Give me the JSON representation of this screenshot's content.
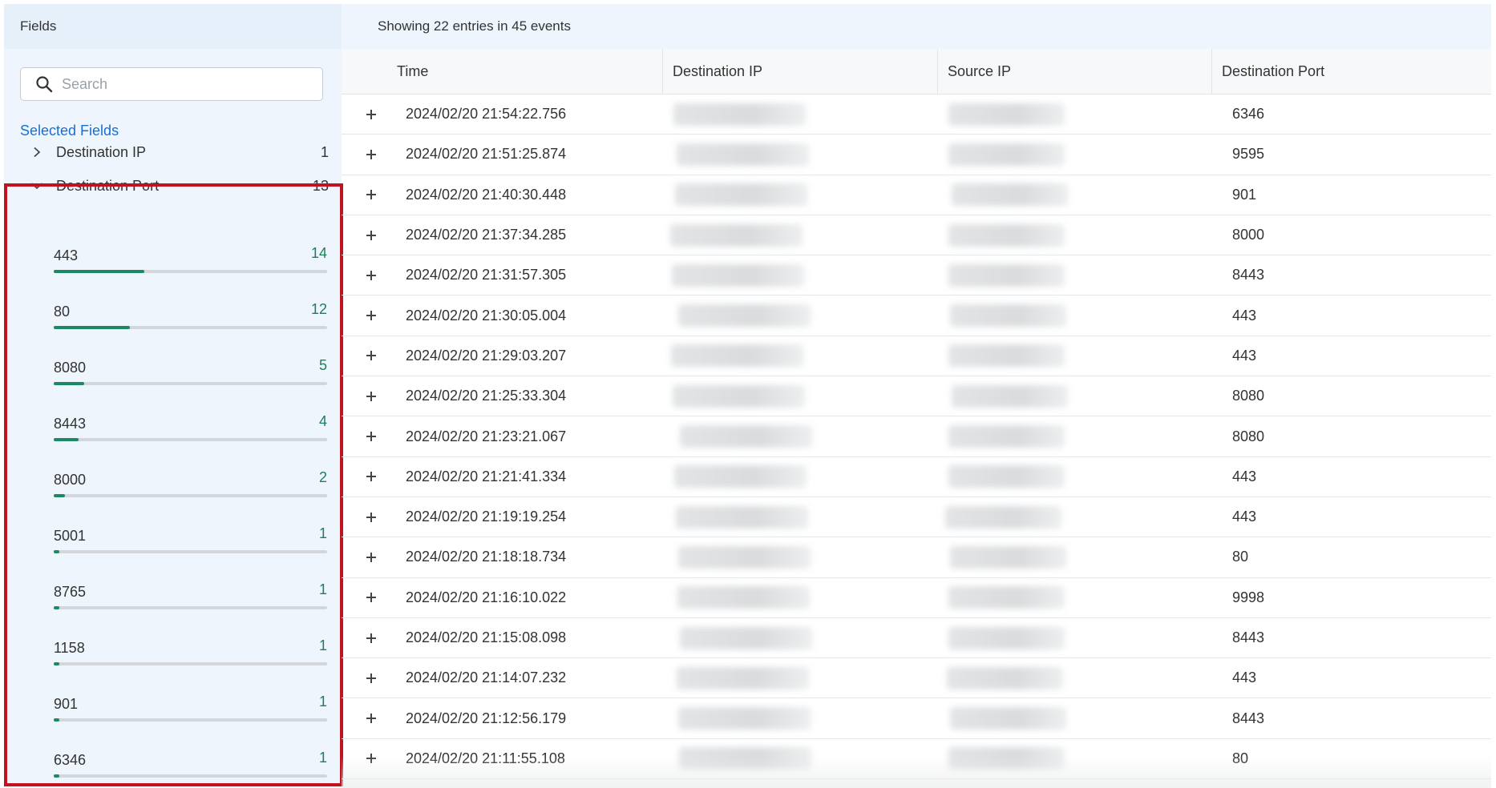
{
  "sidebar": {
    "title": "Fields",
    "search": {
      "placeholder": "Search",
      "value": ""
    },
    "selected_fields_label": "Selected Fields",
    "fields": [
      {
        "name": "Destination IP",
        "count": "1",
        "expanded": false
      },
      {
        "name": "Destination Port",
        "count": "13",
        "expanded": true
      }
    ],
    "port_values": [
      {
        "label": "443",
        "count": "14",
        "fraction": 0.33
      },
      {
        "label": "80",
        "count": "12",
        "fraction": 0.28
      },
      {
        "label": "8080",
        "count": "5",
        "fraction": 0.11
      },
      {
        "label": "8443",
        "count": "4",
        "fraction": 0.09
      },
      {
        "label": "8000",
        "count": "2",
        "fraction": 0.04
      },
      {
        "label": "5001",
        "count": "1",
        "fraction": 0.02
      },
      {
        "label": "8765",
        "count": "1",
        "fraction": 0.02
      },
      {
        "label": "1158",
        "count": "1",
        "fraction": 0.02
      },
      {
        "label": "901",
        "count": "1",
        "fraction": 0.02
      },
      {
        "label": "6346",
        "count": "1",
        "fraction": 0.02
      }
    ]
  },
  "main": {
    "summary": "Showing 22 entries in 45 events",
    "columns": {
      "time": "Time",
      "destination_ip": "Destination IP",
      "source_ip": "Source IP",
      "destination_port": "Destination Port"
    },
    "rows": [
      {
        "time": "2024/02/20 21:54:22.756",
        "port": "6346"
      },
      {
        "time": "2024/02/20 21:51:25.874",
        "port": "9595"
      },
      {
        "time": "2024/02/20 21:40:30.448",
        "port": "901"
      },
      {
        "time": "2024/02/20 21:37:34.285",
        "port": "8000"
      },
      {
        "time": "2024/02/20 21:31:57.305",
        "port": "8443"
      },
      {
        "time": "2024/02/20 21:30:05.004",
        "port": "443"
      },
      {
        "time": "2024/02/20 21:29:03.207",
        "port": "443"
      },
      {
        "time": "2024/02/20 21:25:33.304",
        "port": "8080"
      },
      {
        "time": "2024/02/20 21:23:21.067",
        "port": "8080"
      },
      {
        "time": "2024/02/20 21:21:41.334",
        "port": "443"
      },
      {
        "time": "2024/02/20 21:19:19.254",
        "port": "443"
      },
      {
        "time": "2024/02/20 21:18:18.734",
        "port": "80"
      },
      {
        "time": "2024/02/20 21:16:10.022",
        "port": "9998"
      },
      {
        "time": "2024/02/20 21:15:08.098",
        "port": "8443"
      },
      {
        "time": "2024/02/20 21:14:07.232",
        "port": "443"
      },
      {
        "time": "2024/02/20 21:12:56.179",
        "port": "8443"
      },
      {
        "time": "2024/02/20 21:11:55.108",
        "port": "80"
      }
    ]
  },
  "colors": {
    "accent_link": "#1c6fcf",
    "bar_fill": "#1b8a64",
    "count_text": "#1b7f5c",
    "highlight_border": "#c0131f",
    "sidebar_bg": "#eef5fc"
  },
  "icons": {
    "search": "search-icon",
    "collapsed": "chevron-right-icon",
    "expanded": "chevron-down-icon",
    "expand_row": "plus-icon"
  }
}
